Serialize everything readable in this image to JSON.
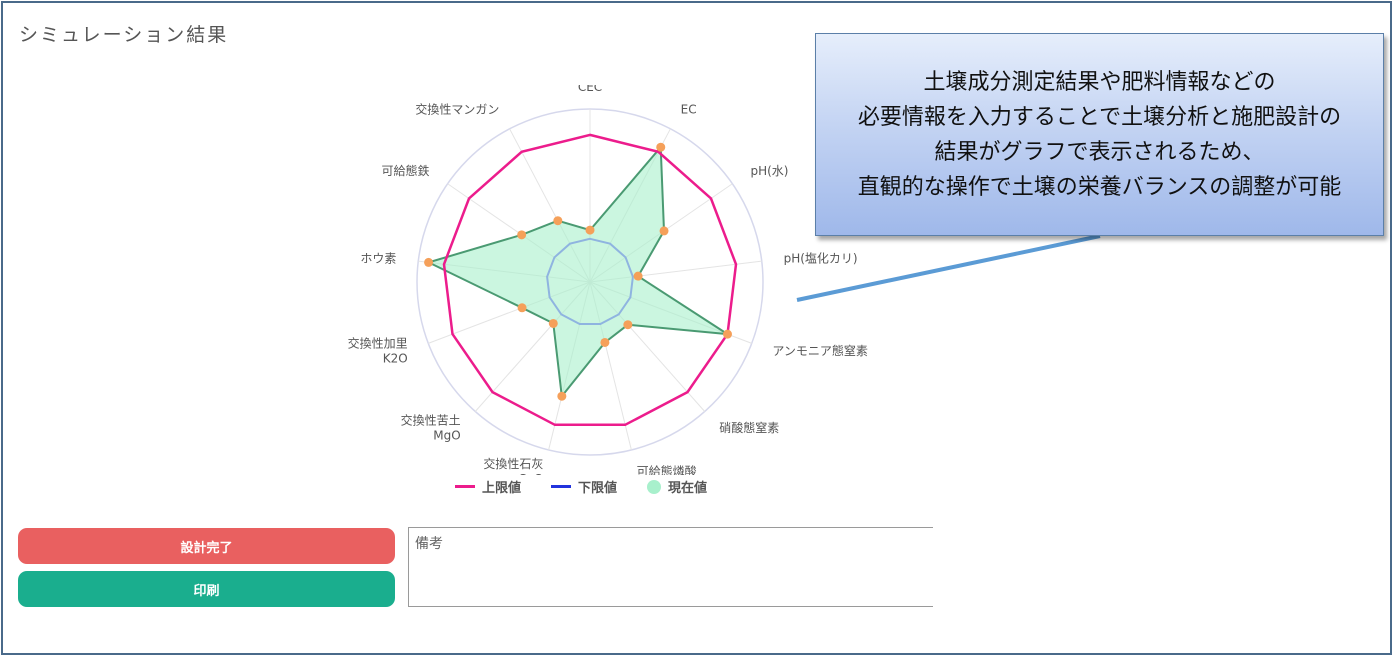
{
  "page": {
    "title": "シミュレーション結果"
  },
  "callout": {
    "lines": [
      "土壌成分測定結果や肥料情報などの",
      "必要情報を入力することで土壌分析と施肥設計の",
      "結果がグラフで表示されるため、",
      "直観的な操作で土壌の栄養バランスの調整が可能"
    ]
  },
  "buttons": {
    "design_complete": "設計完了",
    "print": "印刷"
  },
  "notes": {
    "placeholder": "備考",
    "value": ""
  },
  "chart_data": {
    "type": "radar",
    "axes": [
      [
        "CEC"
      ],
      [
        "EC"
      ],
      [
        "pH(水)"
      ],
      [
        "pH(塩化カリ)"
      ],
      [
        "アンモニア態窒素"
      ],
      [
        "硝酸態窒素"
      ],
      [
        "可給態燐酸"
      ],
      [
        "交換性石灰",
        "CaO"
      ],
      [
        "交換性苦土",
        "MgO"
      ],
      [
        "交換性加里",
        "K2O"
      ],
      [
        "ホウ素"
      ],
      [
        "可給態鉄"
      ],
      [
        "交換性マンガン"
      ]
    ],
    "range": [
      0,
      100
    ],
    "series": [
      {
        "name": "上限値",
        "color": "#ec1c8c",
        "values": [
          85,
          85,
          85,
          85,
          85,
          85,
          85,
          85,
          85,
          85,
          85,
          85,
          85
        ]
      },
      {
        "name": "下限値",
        "color": "#2233dd",
        "values": [
          25,
          25,
          25,
          25,
          25,
          25,
          25,
          25,
          25,
          25,
          25,
          25,
          25
        ]
      },
      {
        "name": "現在値",
        "color": "#a8f0cc",
        "line_color": "#4a9a72",
        "values": [
          30,
          88,
          52,
          28,
          85,
          33,
          36,
          68,
          32,
          42,
          94,
          48,
          40
        ]
      }
    ],
    "point_color": "#f5a05a",
    "grid_color": "#e4e4e4",
    "outer_ring_color": "#d6d8ec",
    "legend_position": "bottom"
  }
}
